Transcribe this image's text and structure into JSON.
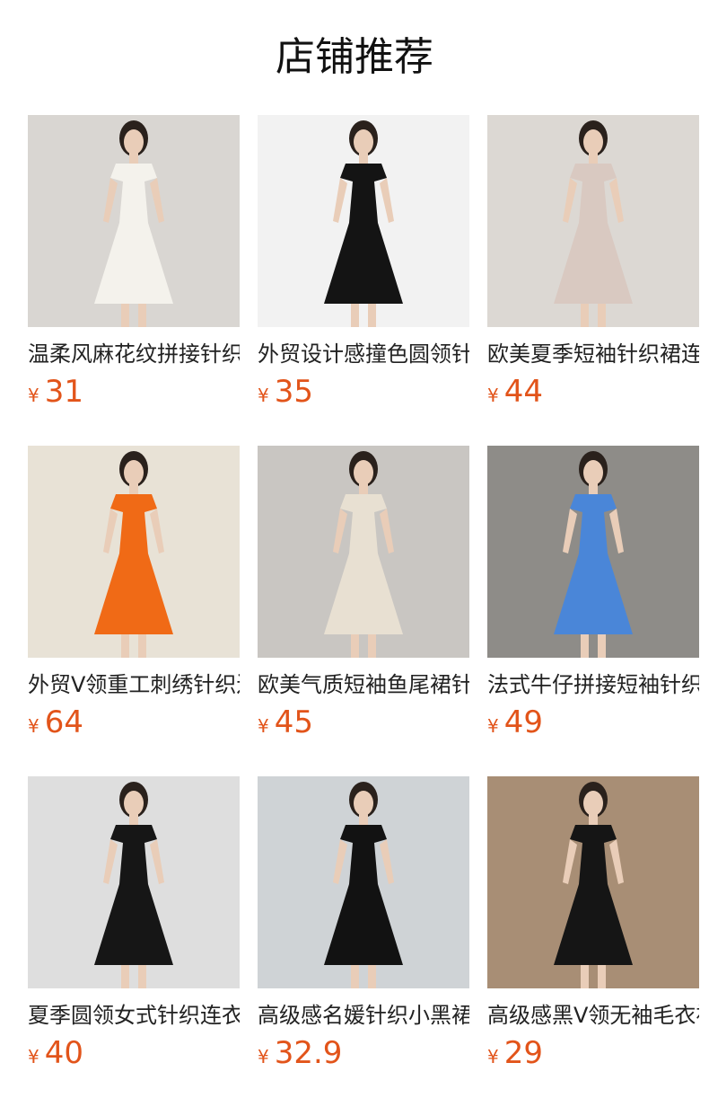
{
  "page": {
    "title": "店铺推荐"
  },
  "theme": {
    "price_color": "#e2541a",
    "title_color": "#222222"
  },
  "products": [
    {
      "title": "温柔风麻花纹拼接针织连衣裙",
      "currency": "¥",
      "price": "31",
      "image": "white-pleated-knit-dress-photo",
      "bg": "#d9d6d2",
      "dress": "#f4f2ec"
    },
    {
      "title": "外贸设计感撞色圆领针织连衣裙",
      "currency": "¥",
      "price": "35",
      "image": "black-trimmed-dress-photo",
      "bg": "#f2f2f2",
      "dress": "#141414"
    },
    {
      "title": "欧美夏季短袖针织裙连衣裙",
      "currency": "¥",
      "price": "44",
      "image": "dotted-beige-dress-photo",
      "bg": "#dcd8d3",
      "dress": "#d9c9c1"
    },
    {
      "title": "外贸V领重工刺绣针织连衣裙",
      "currency": "¥",
      "price": "64",
      "image": "orange-eyelet-dress-photo",
      "bg": "#e8e2d6",
      "dress": "#f06a16"
    },
    {
      "title": "欧美气质短袖鱼尾裙针织连衣裙",
      "currency": "¥",
      "price": "45",
      "image": "cream-mermaid-dress-photo",
      "bg": "#c9c6c2",
      "dress": "#e8e0d2"
    },
    {
      "title": "法式牛仔拼接短袖针织连衣裙",
      "currency": "¥",
      "price": "49",
      "image": "blue-knit-maxi-dress-photo",
      "bg": "#8e8c88",
      "dress": "#4a86d8"
    },
    {
      "title": "夏季圆领女式针织连衣裙",
      "currency": "¥",
      "price": "40",
      "image": "black-pleated-maxi-dress-photo",
      "bg": "#dedede",
      "dress": "#161616"
    },
    {
      "title": "高级感名媛针织小黑裙连衣裙",
      "currency": "¥",
      "price": "32.9",
      "image": "black-pearl-mini-dress-photo",
      "bg": "#cfd3d6",
      "dress": "#121212"
    },
    {
      "title": "高级感黑V领无袖毛衣裙连衣裙",
      "currency": "¥",
      "price": "29",
      "image": "black-sleeveless-knit-dress-photo",
      "bg": "#a88e75",
      "dress": "#151515"
    }
  ]
}
